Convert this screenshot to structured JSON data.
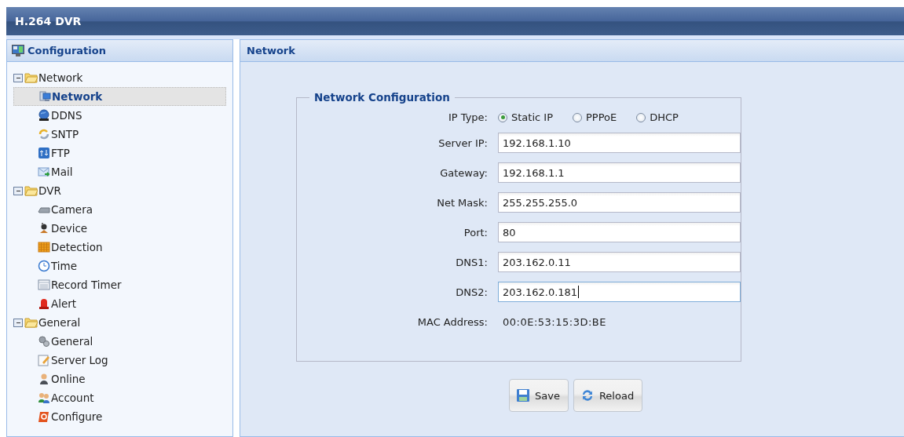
{
  "app": {
    "title": "H.264 DVR"
  },
  "sidebar": {
    "title": "Configuration",
    "groups": [
      {
        "label": "Network",
        "expanded": true,
        "children": [
          {
            "label": "Network",
            "selected": true
          },
          {
            "label": "DDNS",
            "selected": false
          },
          {
            "label": "SNTP",
            "selected": false
          },
          {
            "label": "FTP",
            "selected": false
          },
          {
            "label": "Mail",
            "selected": false
          }
        ]
      },
      {
        "label": "DVR",
        "expanded": true,
        "children": [
          {
            "label": "Camera",
            "selected": false
          },
          {
            "label": "Device",
            "selected": false
          },
          {
            "label": "Detection",
            "selected": false
          },
          {
            "label": "Time",
            "selected": false
          },
          {
            "label": "Record Timer",
            "selected": false
          },
          {
            "label": "Alert",
            "selected": false
          }
        ]
      },
      {
        "label": "General",
        "expanded": true,
        "children": [
          {
            "label": "General",
            "selected": false
          },
          {
            "label": "Server Log",
            "selected": false
          },
          {
            "label": "Online",
            "selected": false
          },
          {
            "label": "Account",
            "selected": false
          },
          {
            "label": "Configure",
            "selected": false
          }
        ]
      }
    ]
  },
  "panel": {
    "title": "Network",
    "section": "Network Configuration",
    "ip_type": {
      "label": "IP Type:",
      "options": [
        {
          "label": "Static IP",
          "selected": true
        },
        {
          "label": "PPPoE",
          "selected": false
        },
        {
          "label": "DHCP",
          "selected": false
        }
      ]
    },
    "fields": [
      {
        "label": "Server IP:",
        "value": "192.168.1.10",
        "focused": false
      },
      {
        "label": "Gateway:",
        "value": "192.168.1.1",
        "focused": false
      },
      {
        "label": "Net Mask:",
        "value": "255.255.255.0",
        "focused": false
      },
      {
        "label": "Port:",
        "value": "80",
        "focused": false
      },
      {
        "label": "DNS1:",
        "value": "203.162.0.11",
        "focused": false
      },
      {
        "label": "DNS2:",
        "value": "203.162.0.181",
        "focused": true
      }
    ],
    "mac": {
      "label": "MAC Address:",
      "value": "00:0E:53:15:3D:BE"
    },
    "buttons": [
      {
        "label": "Save",
        "kind": "save"
      },
      {
        "label": "Reload",
        "kind": "reload"
      }
    ]
  }
}
